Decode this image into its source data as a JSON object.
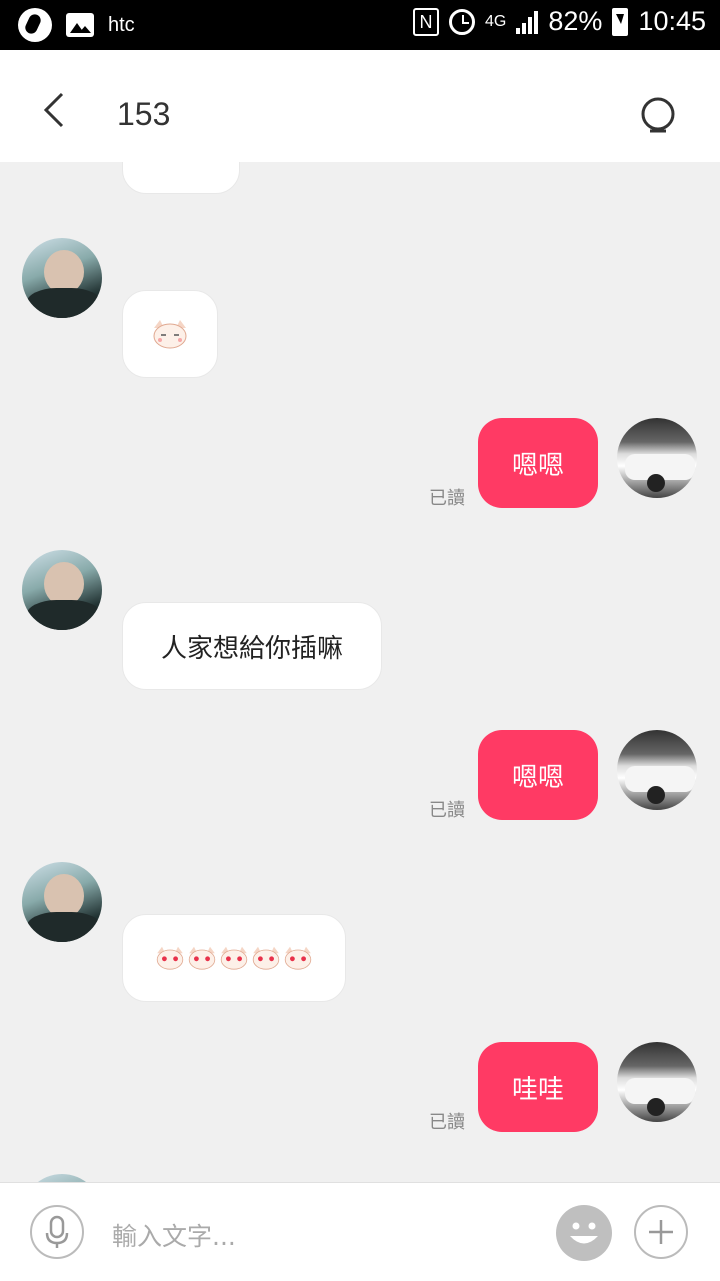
{
  "status_bar": {
    "carrier": "htc",
    "network": "4G",
    "battery": "82%",
    "time": "10:45"
  },
  "header": {
    "title": "153"
  },
  "messages": [
    {
      "id": "m0",
      "side": "in",
      "text": "",
      "note": "partially visible bubble"
    },
    {
      "id": "m1",
      "side": "in",
      "content": "cat-sticker-1"
    },
    {
      "id": "m2",
      "side": "out",
      "text": "嗯嗯",
      "status": "已讀"
    },
    {
      "id": "m3",
      "side": "in",
      "text": "人家想給你插嘛"
    },
    {
      "id": "m4",
      "side": "out",
      "text": "嗯嗯",
      "status": "已讀"
    },
    {
      "id": "m5",
      "side": "in",
      "content": "cat-heart-eyes-x5"
    },
    {
      "id": "m6",
      "side": "out",
      "text": "哇哇",
      "status": "已讀"
    }
  ],
  "input": {
    "placeholder": "輸入文字..."
  },
  "colors": {
    "accent": "#ff3a64",
    "background": "#f0f0f0"
  }
}
